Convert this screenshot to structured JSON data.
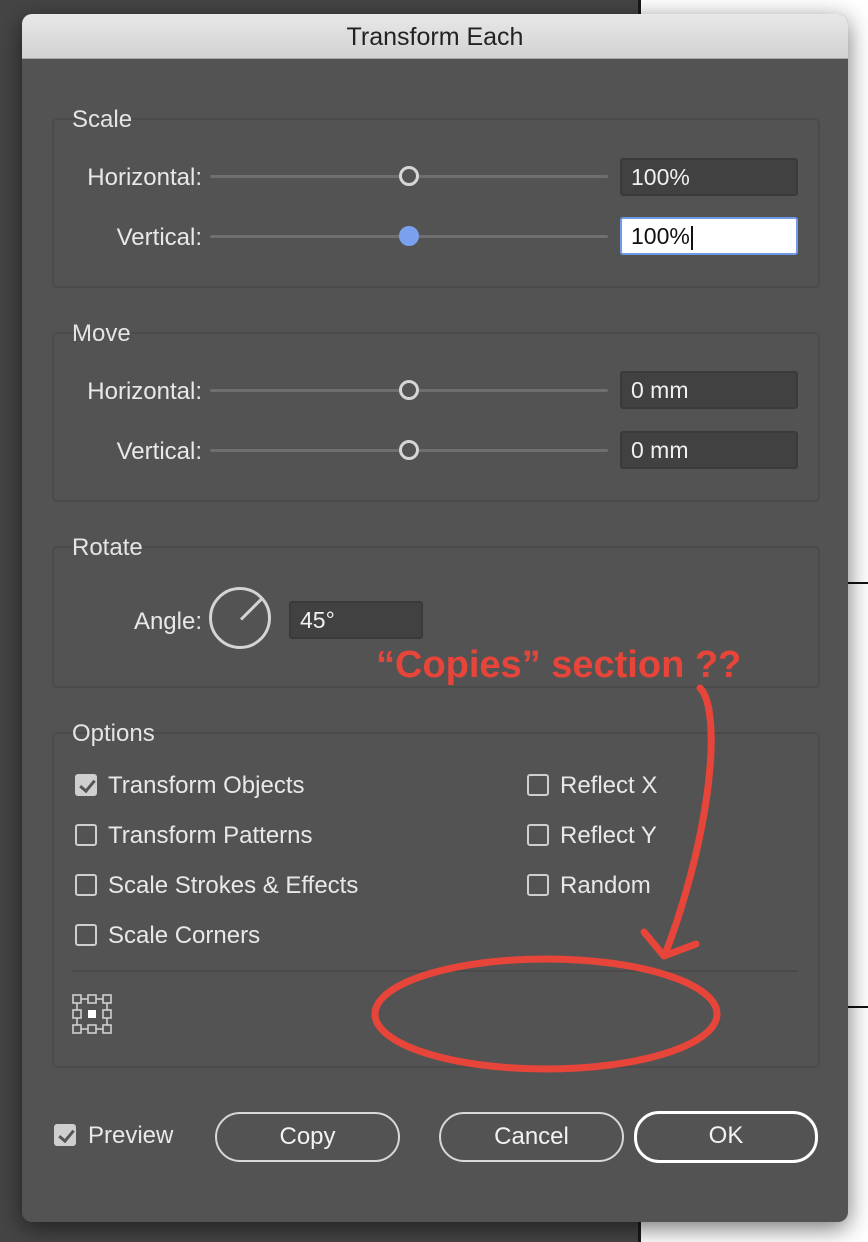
{
  "dialog": {
    "title": "Transform Each"
  },
  "scale": {
    "title": "Scale",
    "horizontal_label": "Horizontal:",
    "horizontal_value": "100%",
    "vertical_label": "Vertical:",
    "vertical_value": "100%"
  },
  "move": {
    "title": "Move",
    "horizontal_label": "Horizontal:",
    "horizontal_value": "0 mm",
    "vertical_label": "Vertical:",
    "vertical_value": "0 mm"
  },
  "rotate": {
    "title": "Rotate",
    "angle_label": "Angle:",
    "angle_value": "45°",
    "angle_degrees": 45
  },
  "options": {
    "title": "Options",
    "transform_objects": {
      "label": "Transform Objects",
      "checked": true
    },
    "transform_patterns": {
      "label": "Transform Patterns",
      "checked": false
    },
    "scale_strokes": {
      "label": "Scale Strokes & Effects",
      "checked": false
    },
    "scale_corners": {
      "label": "Scale Corners",
      "checked": false
    },
    "reflect_x": {
      "label": "Reflect X",
      "checked": false
    },
    "reflect_y": {
      "label": "Reflect Y",
      "checked": false
    },
    "random": {
      "label": "Random",
      "checked": false
    }
  },
  "footer": {
    "preview": {
      "label": "Preview",
      "checked": true
    },
    "copy_label": "Copy",
    "cancel_label": "Cancel",
    "ok_label": "OK"
  },
  "annotation": {
    "text": "“Copies” section ??",
    "color": "#e8453a"
  },
  "colors": {
    "panel": "#535353",
    "focus": "#7aa0ee"
  }
}
